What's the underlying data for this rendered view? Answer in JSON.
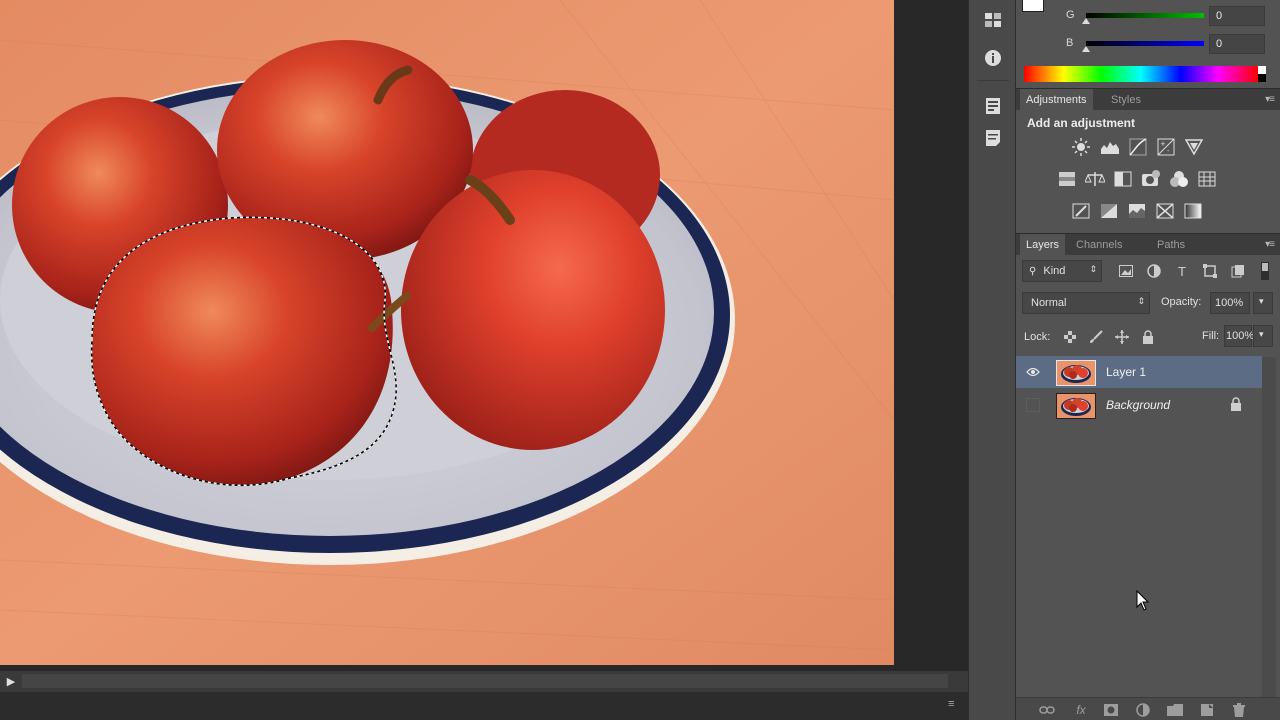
{
  "color_panel": {
    "sliders": [
      {
        "label": "G",
        "value": "0",
        "color": "#00c000"
      },
      {
        "label": "B",
        "value": "0",
        "color": "#0000ff"
      }
    ]
  },
  "adjustments_panel": {
    "tabs": [
      {
        "label": "Adjustments"
      },
      {
        "label": "Styles"
      }
    ],
    "active_tab": "Adjustments",
    "heading": "Add an adjustment"
  },
  "layers_panel": {
    "tabs": [
      {
        "label": "Layers"
      },
      {
        "label": "Channels"
      },
      {
        "label": "Paths"
      }
    ],
    "active_tab": "Layers",
    "filter_kind": "Kind",
    "blend_mode": "Normal",
    "opacity_label": "Opacity:",
    "opacity_value": "100%",
    "lock_label": "Lock:",
    "fill_label": "Fill:",
    "fill_value": "100%",
    "layers": [
      {
        "name": "Layer 1",
        "visible": true,
        "selected": true,
        "locked": false
      },
      {
        "name": "Background",
        "visible": false,
        "selected": false,
        "locked": true
      }
    ]
  },
  "colors": {
    "selection_highlight": "#5b6c84",
    "panel_bg": "#535353",
    "tab_bar_bg": "#3c3c3c",
    "canvas_wood": "#e8936a"
  },
  "icons": {
    "dock": [
      "brush-presets-icon",
      "info-icon",
      "properties-icon",
      "notes-icon"
    ],
    "adjustments_row1": [
      "brightness-contrast-icon",
      "levels-icon",
      "curves-icon",
      "exposure-icon",
      "vibrance-icon"
    ],
    "adjustments_row2": [
      "hue-saturation-icon",
      "color-balance-icon",
      "black-white-icon",
      "photo-filter-icon",
      "channel-mixer-icon",
      "color-lookup-icon"
    ],
    "adjustments_row3": [
      "invert-icon",
      "posterize-icon",
      "threshold-icon",
      "selective-color-icon",
      "gradient-map-icon"
    ],
    "layer_footer": [
      "link-layers-icon",
      "fx-icon",
      "layer-mask-icon",
      "new-adjustment-layer-icon",
      "new-group-icon",
      "new-layer-icon",
      "delete-layer-icon"
    ]
  }
}
